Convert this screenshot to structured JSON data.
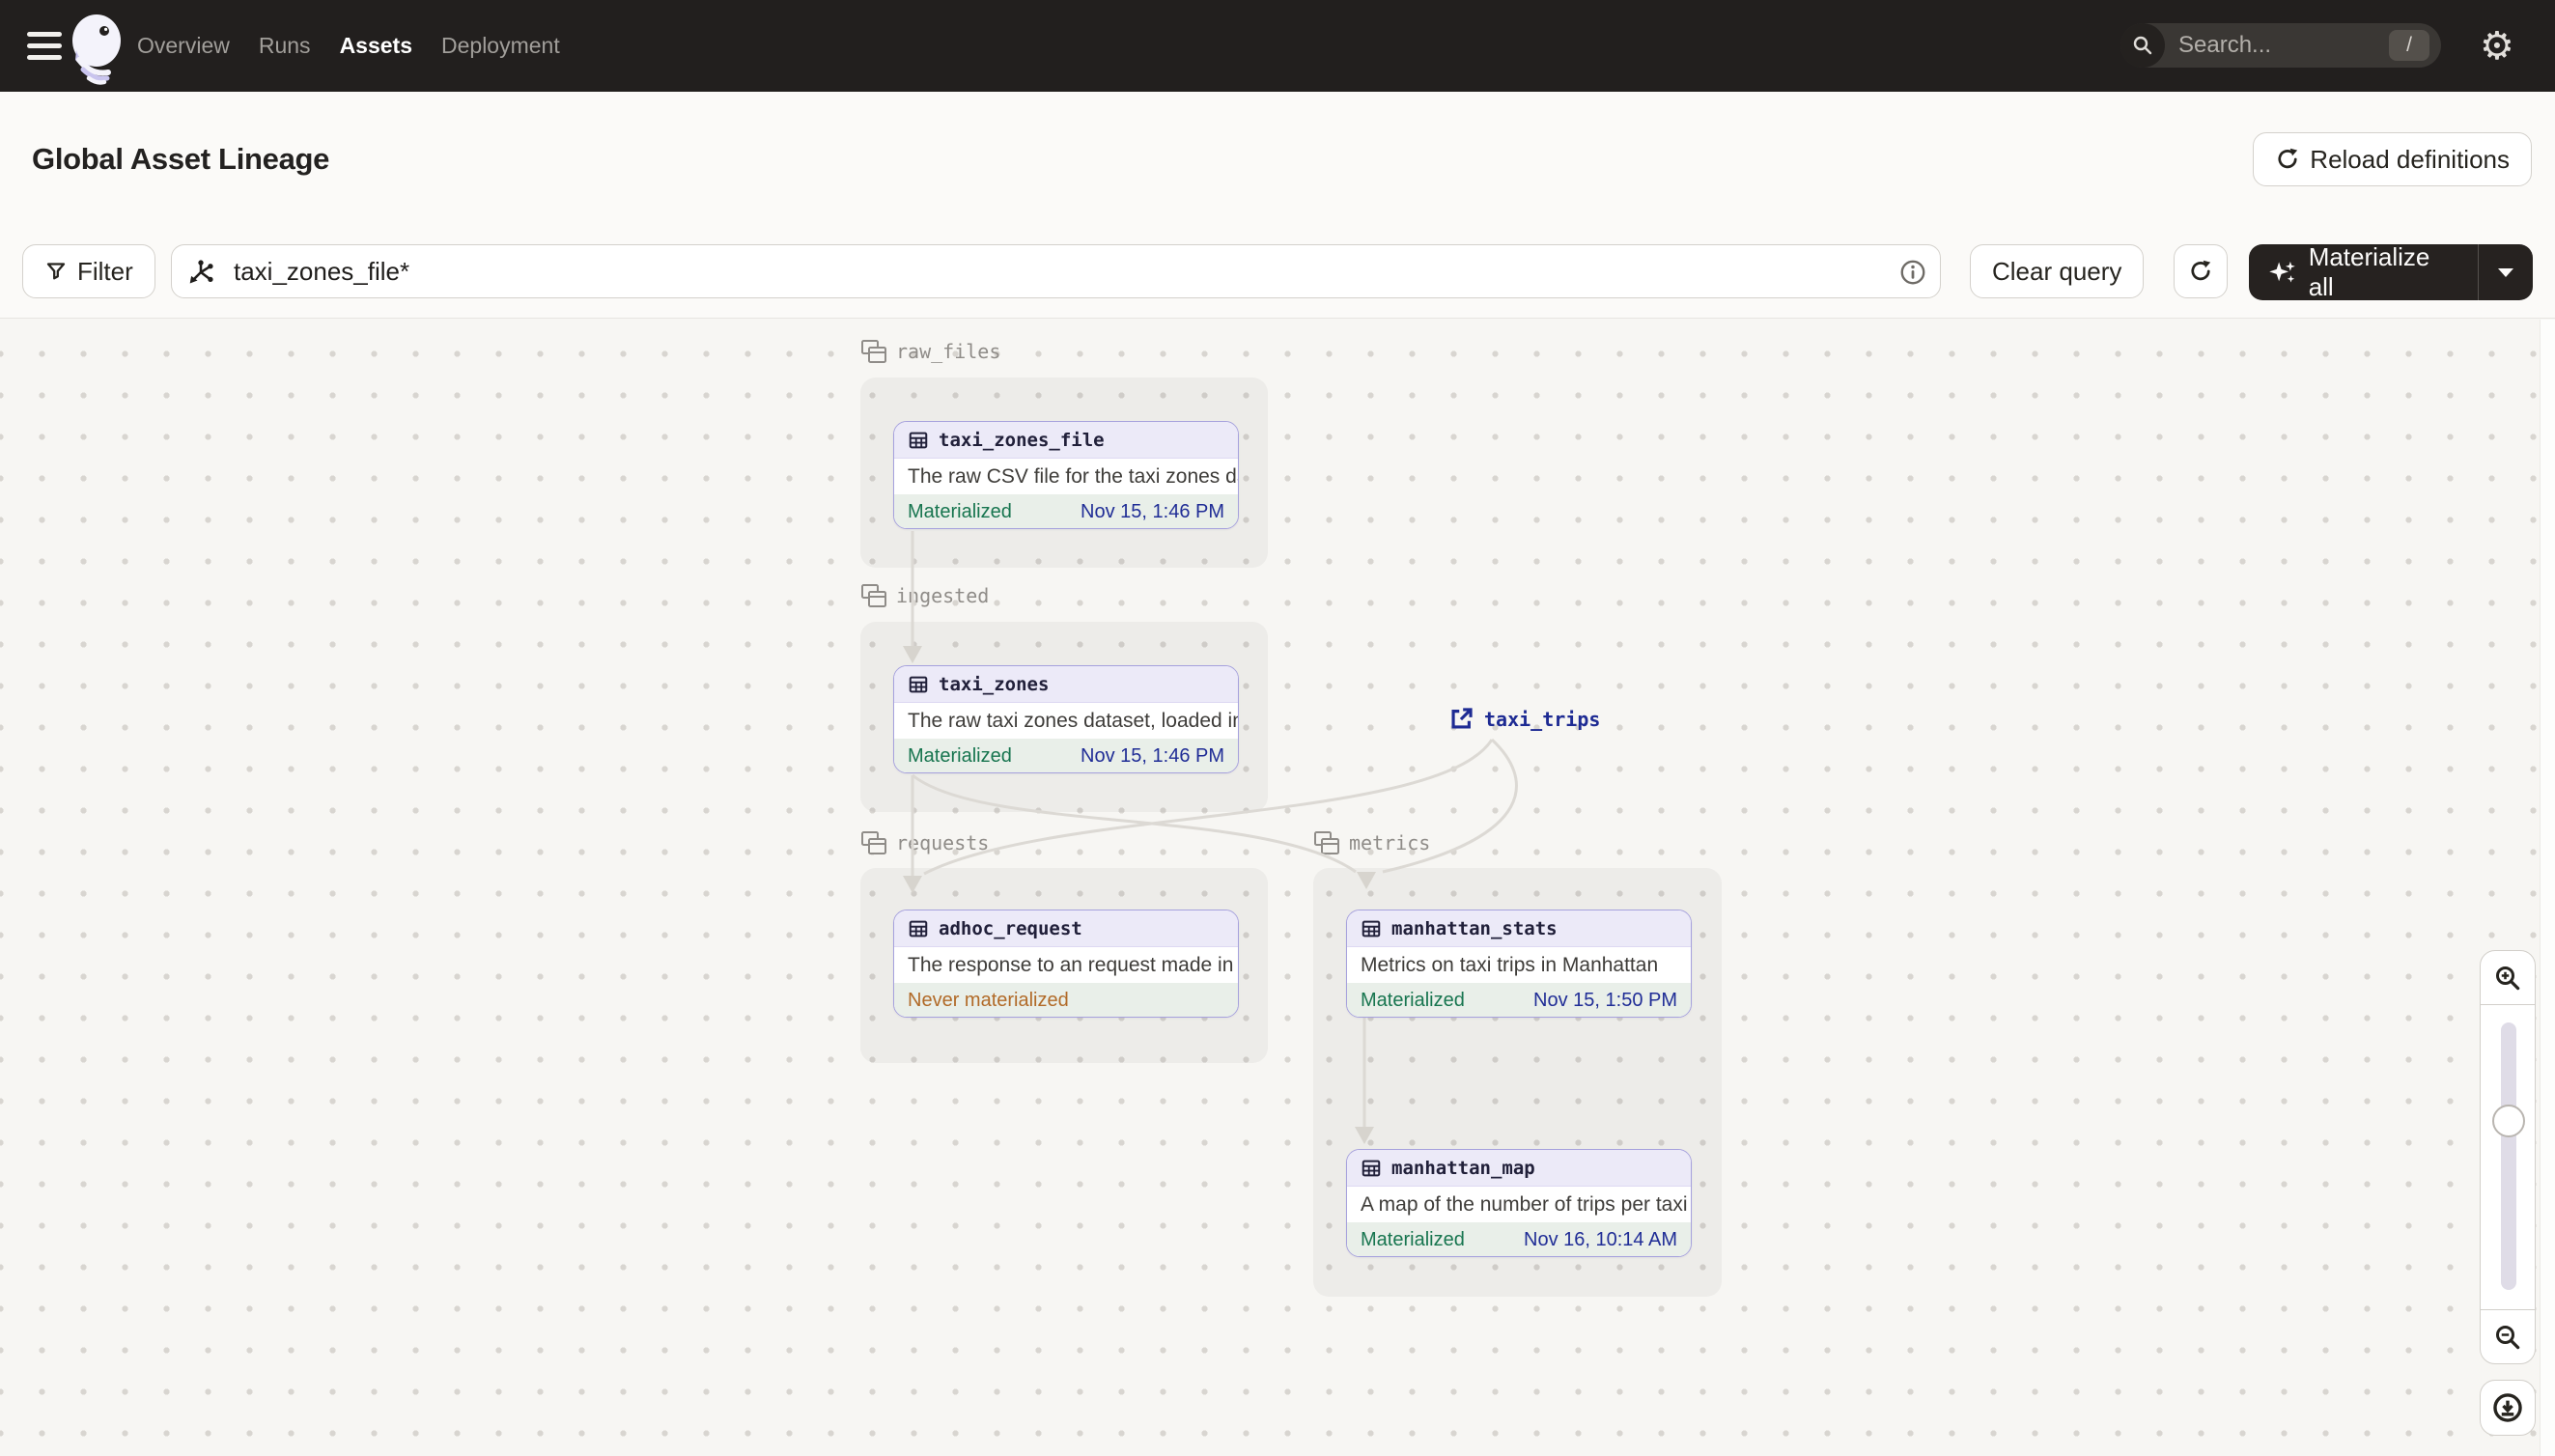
{
  "nav": {
    "links": [
      {
        "label": "Overview",
        "active": false
      },
      {
        "label": "Runs",
        "active": false
      },
      {
        "label": "Assets",
        "active": true
      },
      {
        "label": "Deployment",
        "active": false
      }
    ],
    "search_placeholder": "Search...",
    "search_shortcut": "/"
  },
  "header": {
    "title": "Global Asset Lineage",
    "reload_label": "Reload definitions"
  },
  "toolbar": {
    "filter_label": "Filter",
    "query_value": "taxi_zones_file*",
    "clear_label": "Clear query",
    "materialize_label": "Materialize all"
  },
  "graph": {
    "groups": [
      {
        "name": "raw_files"
      },
      {
        "name": "ingested"
      },
      {
        "name": "requests"
      },
      {
        "name": "metrics"
      }
    ],
    "nodes": [
      {
        "name": "taxi_zones_file",
        "description": "The raw CSV file for the taxi zones dat...",
        "status": "Materialized",
        "timestamp": "Nov 15, 1:46 PM",
        "group": "raw_files"
      },
      {
        "name": "taxi_zones",
        "description": "The raw taxi zones dataset, loaded int...",
        "status": "Materialized",
        "timestamp": "Nov 15, 1:46 PM",
        "group": "ingested"
      },
      {
        "name": "adhoc_request",
        "description": "The response to an request made in th...",
        "status": "Never materialized",
        "timestamp": "",
        "group": "requests"
      },
      {
        "name": "manhattan_stats",
        "description": "Metrics on taxi trips in Manhattan",
        "status": "Materialized",
        "timestamp": "Nov 15, 1:50 PM",
        "group": "metrics"
      },
      {
        "name": "manhattan_map",
        "description": "A map of the number of trips per taxi z...",
        "status": "Materialized",
        "timestamp": "Nov 16, 10:14 AM",
        "group": "metrics"
      }
    ],
    "external_assets": [
      {
        "name": "taxi_trips"
      }
    ]
  },
  "colors": {
    "accent_purple": "#A6A1DD",
    "materialized_green": "#17754F",
    "never_materialized_orange": "#B16A28",
    "timestamp_navy": "#202D96",
    "edge_gray": "#DCD9D4",
    "nav_background": "#221F1E"
  }
}
